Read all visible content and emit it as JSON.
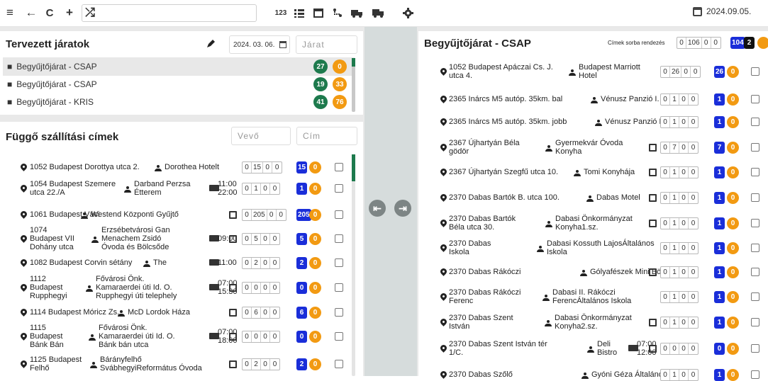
{
  "toolbar": {
    "date": "2024.09.05.",
    "shuffle": "⤮",
    "plus": "+",
    "refresh": "C",
    "back": "←",
    "menu": "≡",
    "num": "123"
  },
  "planned": {
    "title": "Tervezett járatok",
    "date": "2024. 03. 06.",
    "search_placeholder": "Járat",
    "rows": [
      {
        "label": "Begyűjtőjárat - CSAP",
        "a": "27",
        "b": "0",
        "selected": true
      },
      {
        "label": "Begyűjtőjárat - CSAP",
        "a": "19",
        "b": "33"
      },
      {
        "label": "Begyűjtőjárat - KRIS",
        "a": "41",
        "b": "76"
      }
    ]
  },
  "pending": {
    "title": "Függő szállítási címek",
    "buyer_placeholder": "Vevő",
    "address_placeholder": "Cím",
    "rows": [
      {
        "addr": [
          "1052 Budapest Dorottya utca 2."
        ],
        "person": [
          "Dorothea Hotelt"
        ],
        "time": "",
        "doc": false,
        "c": [
          "0",
          "15",
          "0",
          "0"
        ],
        "blue": "15",
        "or": "0"
      },
      {
        "addr": [
          "1054 Budapest Szemere",
          "utca 22./A"
        ],
        "person": [
          "Darband Perzsa",
          "Étterem"
        ],
        "time": "11:00|22:00",
        "doc": false,
        "c": [
          "0",
          "1",
          "0",
          "0"
        ],
        "blue": "1",
        "or": "0"
      },
      {
        "addr": [
          "1061 Budapest Váci"
        ],
        "person": [
          "Westend Központi Gyűjtő"
        ],
        "time": "",
        "doc": true,
        "c": [
          "0",
          "205",
          "0",
          "0"
        ],
        "blue": "205",
        "or": "0"
      },
      {
        "addr": [
          "1074",
          "Budapest VII",
          "Dohány utca"
        ],
        "person": [
          "Erzsébetvárosi Gan",
          "Menachem Zsidó",
          "Óvoda és Bölcsőde"
        ],
        "time": "09:00",
        "doc": true,
        "c": [
          "0",
          "5",
          "0",
          "0"
        ],
        "blue": "5",
        "or": "0"
      },
      {
        "addr": [
          "1082 Budapest Corvin sétány"
        ],
        "person": [
          "The"
        ],
        "time": "11:00",
        "doc": false,
        "c": [
          "0",
          "2",
          "0",
          "0"
        ],
        "blue": "2",
        "or": "0"
      },
      {
        "addr": [
          "1112",
          "Budapest",
          "Rupphegyi"
        ],
        "person": [
          "Fővárosi Önk.",
          "Kamaraerdei úti Id. O.",
          "Rupphegyi úti telephely"
        ],
        "time": "07:00|15:30",
        "doc": true,
        "c": [
          "0",
          "0",
          "0",
          "0"
        ],
        "blue": "0",
        "or": "0"
      },
      {
        "addr": [
          "1114 Budapest Móricz Zs."
        ],
        "person": [
          "McD Lordok Háza"
        ],
        "time": "",
        "doc": true,
        "c": [
          "0",
          "6",
          "0",
          "0"
        ],
        "blue": "6",
        "or": "0"
      },
      {
        "addr": [
          "1115",
          "Budapest",
          "Bánk Bán"
        ],
        "person": [
          "Fővárosi Önk.",
          "Kamaraerdei úti Id. O.",
          "Bánk bán utca"
        ],
        "time": "07:00|18:00",
        "doc": true,
        "c": [
          "0",
          "0",
          "0",
          "0"
        ],
        "blue": "0",
        "or": "0"
      },
      {
        "addr": [
          "1125 Budapest",
          "Felhő"
        ],
        "person": [
          "Bárányfelhő",
          "SvábhegyiReformátus Óvoda"
        ],
        "time": "",
        "doc": true,
        "c": [
          "0",
          "2",
          "0",
          "0"
        ],
        "blue": "2",
        "or": "0"
      }
    ]
  },
  "route": {
    "title": "Begyűjtőjárat - CSAP",
    "sort_label": "Címek sorba rendezés",
    "totals": [
      "0",
      "106",
      "0",
      "0"
    ],
    "total_blue": "104",
    "total_black": "2",
    "rows": [
      {
        "addr": [
          "1052 Budapest Apáczai Cs. J.",
          "utca 4."
        ],
        "person": [
          "Budapest Marriott",
          "Hotel"
        ],
        "time": "",
        "doc": false,
        "c": [
          "0",
          "26",
          "0",
          "0"
        ],
        "blue": "26",
        "or": "0"
      },
      {
        "addr": [
          "2365 Inárcs M5 autóp. 35km. bal"
        ],
        "person": [
          "Vénusz Panzió I."
        ],
        "time": "",
        "doc": false,
        "c": [
          "0",
          "1",
          "0",
          "0"
        ],
        "blue": "1",
        "or": "0"
      },
      {
        "addr": [
          "2365 Inárcs M5 autóp. 35km. jobb"
        ],
        "person": [
          "Vénusz Panzió II."
        ],
        "time": "",
        "doc": false,
        "c": [
          "0",
          "1",
          "0",
          "0"
        ],
        "blue": "1",
        "or": "0"
      },
      {
        "addr": [
          "2367 Újhartyán Béla",
          "gödör"
        ],
        "person": [
          "Gyermekvár Óvoda",
          "Konyha"
        ],
        "time": "",
        "doc": true,
        "c": [
          "0",
          "7",
          "0",
          "0"
        ],
        "blue": "7",
        "or": "0"
      },
      {
        "addr": [
          "2367 Újhartyán Szegfű utca 10."
        ],
        "person": [
          "Tomi Konyhája"
        ],
        "time": "",
        "doc": true,
        "c": [
          "0",
          "1",
          "0",
          "0"
        ],
        "blue": "1",
        "or": "0"
      },
      {
        "addr": [
          "2370 Dabas Bartók B. utca 100."
        ],
        "person": [
          "Dabas Motel"
        ],
        "time": "",
        "doc": true,
        "c": [
          "0",
          "1",
          "0",
          "0"
        ],
        "blue": "1",
        "or": "0"
      },
      {
        "addr": [
          "2370 Dabas Bartók",
          "Béla utca 30."
        ],
        "person": [
          "Dabasi Önkormányzat",
          "Konyha1.sz."
        ],
        "time": "",
        "doc": true,
        "c": [
          "0",
          "1",
          "0",
          "0"
        ],
        "blue": "1",
        "or": "0"
      },
      {
        "addr": [
          "2370 Dabas",
          "Iskola"
        ],
        "person": [
          "Dabasi Kossuth LajosÁltalános",
          "Iskola"
        ],
        "time": "",
        "doc": false,
        "c": [
          "0",
          "1",
          "0",
          "0"
        ],
        "blue": "1",
        "or": "0"
      },
      {
        "addr": [
          "2370 Dabas Rákóczi"
        ],
        "person": [
          "Gólyafészek Mini Bölcsőde"
        ],
        "time": "",
        "doc": true,
        "c": [
          "0",
          "1",
          "0",
          "0"
        ],
        "blue": "1",
        "or": "0"
      },
      {
        "addr": [
          "2370 Dabas Rákóczi",
          "Ferenc"
        ],
        "person": [
          "Dabasi II. Rákóczi",
          "FerencÁltalános Iskola"
        ],
        "time": "",
        "doc": false,
        "c": [
          "0",
          "1",
          "0",
          "0"
        ],
        "blue": "1",
        "or": "0"
      },
      {
        "addr": [
          "2370 Dabas Szent",
          "István"
        ],
        "person": [
          "Dabasi Önkormányzat",
          "Konyha2.sz."
        ],
        "time": "",
        "doc": true,
        "c": [
          "0",
          "1",
          "0",
          "0"
        ],
        "blue": "1",
        "or": "0"
      },
      {
        "addr": [
          "2370 Dabas Szent István tér",
          "1/C."
        ],
        "person": [
          "Deli",
          "Bistro"
        ],
        "time": "07:00|12:00",
        "doc": true,
        "c": [
          "0",
          "0",
          "0",
          "0"
        ],
        "blue": "0",
        "or": "0"
      },
      {
        "addr": [
          "2370 Dabas Szőlő"
        ],
        "person": [
          "Gyóni Géza Általános Iskola"
        ],
        "time": "",
        "doc": false,
        "c": [
          "0",
          "1",
          "0",
          "0"
        ],
        "blue": "1",
        "or": "0"
      }
    ]
  }
}
